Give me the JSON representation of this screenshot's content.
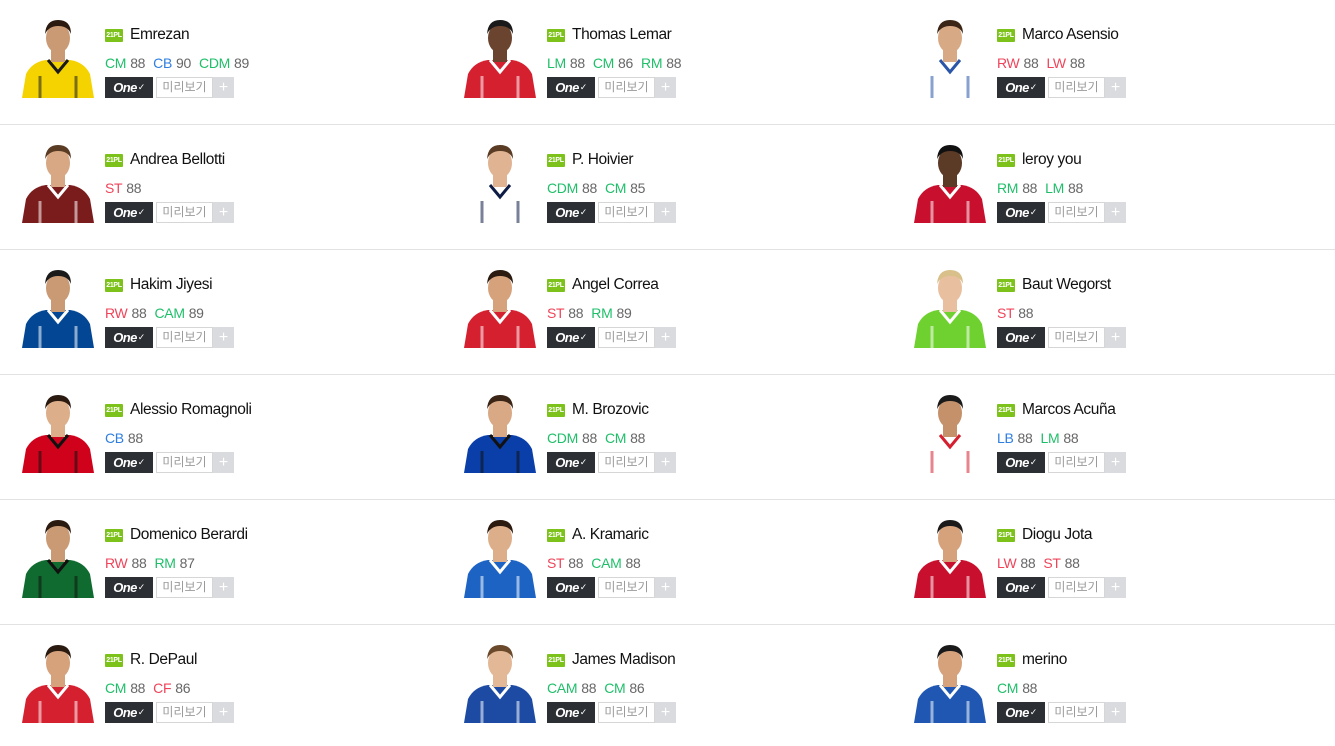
{
  "colors": {
    "position_green": "#1fbf6a",
    "position_blue": "#2f7ee0",
    "position_red": "#f0445a",
    "ovr_gray": "#666666",
    "season_badge": "#7cc21a",
    "one_button": "#2c2f34"
  },
  "labels": {
    "one_button": "One",
    "one_check": "✓",
    "preview_button": "미리보기",
    "plus_button": "+"
  },
  "players": [
    {
      "season": "21PL",
      "name": "Emrezan",
      "kit": [
        "#f5d300",
        "#1a1a1a"
      ],
      "skin": "#c99a74",
      "hair": "#2a1a10",
      "positions": [
        {
          "pos": "CM",
          "ovr": "88",
          "color": "green"
        },
        {
          "pos": "CB",
          "ovr": "90",
          "color": "blue"
        },
        {
          "pos": "CDM",
          "ovr": "89",
          "color": "green"
        }
      ]
    },
    {
      "season": "21PL",
      "name": "Thomas Lemar",
      "kit": [
        "#d52030",
        "#ffffff"
      ],
      "skin": "#6b4430",
      "hair": "#1a1a1a",
      "positions": [
        {
          "pos": "LM",
          "ovr": "88",
          "color": "green"
        },
        {
          "pos": "CM",
          "ovr": "86",
          "color": "green"
        },
        {
          "pos": "RM",
          "ovr": "88",
          "color": "green"
        }
      ]
    },
    {
      "season": "21PL",
      "name": "Marco Asensio",
      "kit": [
        "#ffffff",
        "#2a55a8"
      ],
      "skin": "#d8a985",
      "hair": "#3a2517",
      "positions": [
        {
          "pos": "RW",
          "ovr": "88",
          "color": "red"
        },
        {
          "pos": "LW",
          "ovr": "88",
          "color": "red"
        }
      ]
    },
    {
      "season": "21PL",
      "name": "Andrea Bellotti",
      "kit": [
        "#7a1c1c",
        "#ffffff"
      ],
      "skin": "#d7a883",
      "hair": "#5a3b24",
      "positions": [
        {
          "pos": "ST",
          "ovr": "88",
          "color": "red"
        }
      ]
    },
    {
      "season": "21PL",
      "name": "P. Hoivier",
      "kit": [
        "#ffffff",
        "#0d1b45"
      ],
      "skin": "#e0b493",
      "hair": "#5a3b24",
      "positions": [
        {
          "pos": "CDM",
          "ovr": "88",
          "color": "green"
        },
        {
          "pos": "CM",
          "ovr": "85",
          "color": "green"
        }
      ]
    },
    {
      "season": "21PL",
      "name": "leroy you",
      "kit": [
        "#c8102e",
        "#ffffff"
      ],
      "skin": "#5b3a26",
      "hair": "#111111",
      "positions": [
        {
          "pos": "RM",
          "ovr": "88",
          "color": "green"
        },
        {
          "pos": "LM",
          "ovr": "88",
          "color": "green"
        }
      ]
    },
    {
      "season": "21PL",
      "name": "Hakim Jiyesi",
      "kit": [
        "#034694",
        "#ffffff"
      ],
      "skin": "#c99a74",
      "hair": "#1a1a1a",
      "positions": [
        {
          "pos": "RW",
          "ovr": "88",
          "color": "red"
        },
        {
          "pos": "CAM",
          "ovr": "89",
          "color": "green"
        }
      ]
    },
    {
      "season": "21PL",
      "name": "Angel Correa",
      "kit": [
        "#d52030",
        "#ffffff"
      ],
      "skin": "#d5a27c",
      "hair": "#2a1a10",
      "positions": [
        {
          "pos": "ST",
          "ovr": "88",
          "color": "red"
        },
        {
          "pos": "RM",
          "ovr": "89",
          "color": "green"
        }
      ]
    },
    {
      "season": "21PL",
      "name": "Baut Wegorst",
      "kit": [
        "#6fd12f",
        "#ffffff"
      ],
      "skin": "#e8c0a0",
      "hair": "#d9c08a",
      "positions": [
        {
          "pos": "ST",
          "ovr": "88",
          "color": "red"
        }
      ]
    },
    {
      "season": "21PL",
      "name": "Alessio Romagnoli",
      "kit": [
        "#d0021b",
        "#111111"
      ],
      "skin": "#dcae8a",
      "hair": "#2a1a10",
      "positions": [
        {
          "pos": "CB",
          "ovr": "88",
          "color": "blue"
        }
      ]
    },
    {
      "season": "21PL",
      "name": "M. Brozovic",
      "kit": [
        "#0a3ea8",
        "#111111"
      ],
      "skin": "#d9a985",
      "hair": "#3a2517",
      "positions": [
        {
          "pos": "CDM",
          "ovr": "88",
          "color": "green"
        },
        {
          "pos": "CM",
          "ovr": "88",
          "color": "green"
        }
      ]
    },
    {
      "season": "21PL",
      "name": "Marcos Acuña",
      "kit": [
        "#ffffff",
        "#d52030"
      ],
      "skin": "#c4916a",
      "hair": "#1a1a1a",
      "positions": [
        {
          "pos": "LB",
          "ovr": "88",
          "color": "blue"
        },
        {
          "pos": "LM",
          "ovr": "88",
          "color": "green"
        }
      ]
    },
    {
      "season": "21PL",
      "name": "Domenico Berardi",
      "kit": [
        "#0f6b2f",
        "#111111"
      ],
      "skin": "#c99a74",
      "hair": "#2a1a10",
      "positions": [
        {
          "pos": "RW",
          "ovr": "88",
          "color": "red"
        },
        {
          "pos": "RM",
          "ovr": "87",
          "color": "green"
        }
      ]
    },
    {
      "season": "21PL",
      "name": "A. Kramaric",
      "kit": [
        "#1c63c4",
        "#ffffff"
      ],
      "skin": "#dcae8a",
      "hair": "#2a1a10",
      "positions": [
        {
          "pos": "ST",
          "ovr": "88",
          "color": "red"
        },
        {
          "pos": "CAM",
          "ovr": "88",
          "color": "green"
        }
      ]
    },
    {
      "season": "21PL",
      "name": "Diogu Jota",
      "kit": [
        "#c8102e",
        "#ffffff"
      ],
      "skin": "#d5a27c",
      "hair": "#1a1a1a",
      "positions": [
        {
          "pos": "LW",
          "ovr": "88",
          "color": "red"
        },
        {
          "pos": "ST",
          "ovr": "88",
          "color": "red"
        }
      ]
    },
    {
      "season": "21PL",
      "name": "R. DePaul",
      "kit": [
        "#d52030",
        "#ffffff"
      ],
      "skin": "#d5a27c",
      "hair": "#2a1a10",
      "positions": [
        {
          "pos": "CM",
          "ovr": "88",
          "color": "green"
        },
        {
          "pos": "CF",
          "ovr": "86",
          "color": "red"
        }
      ]
    },
    {
      "season": "21PL",
      "name": "James Madison",
      "kit": [
        "#1d4ba3",
        "#ffffff"
      ],
      "skin": "#e3b896",
      "hair": "#6a4a2a",
      "positions": [
        {
          "pos": "CAM",
          "ovr": "88",
          "color": "green"
        },
        {
          "pos": "CM",
          "ovr": "86",
          "color": "green"
        }
      ]
    },
    {
      "season": "21PL",
      "name": "merino",
      "kit": [
        "#1f57b3",
        "#ffffff"
      ],
      "skin": "#d5a27c",
      "hair": "#1a1a1a",
      "positions": [
        {
          "pos": "CM",
          "ovr": "88",
          "color": "green"
        }
      ]
    }
  ]
}
